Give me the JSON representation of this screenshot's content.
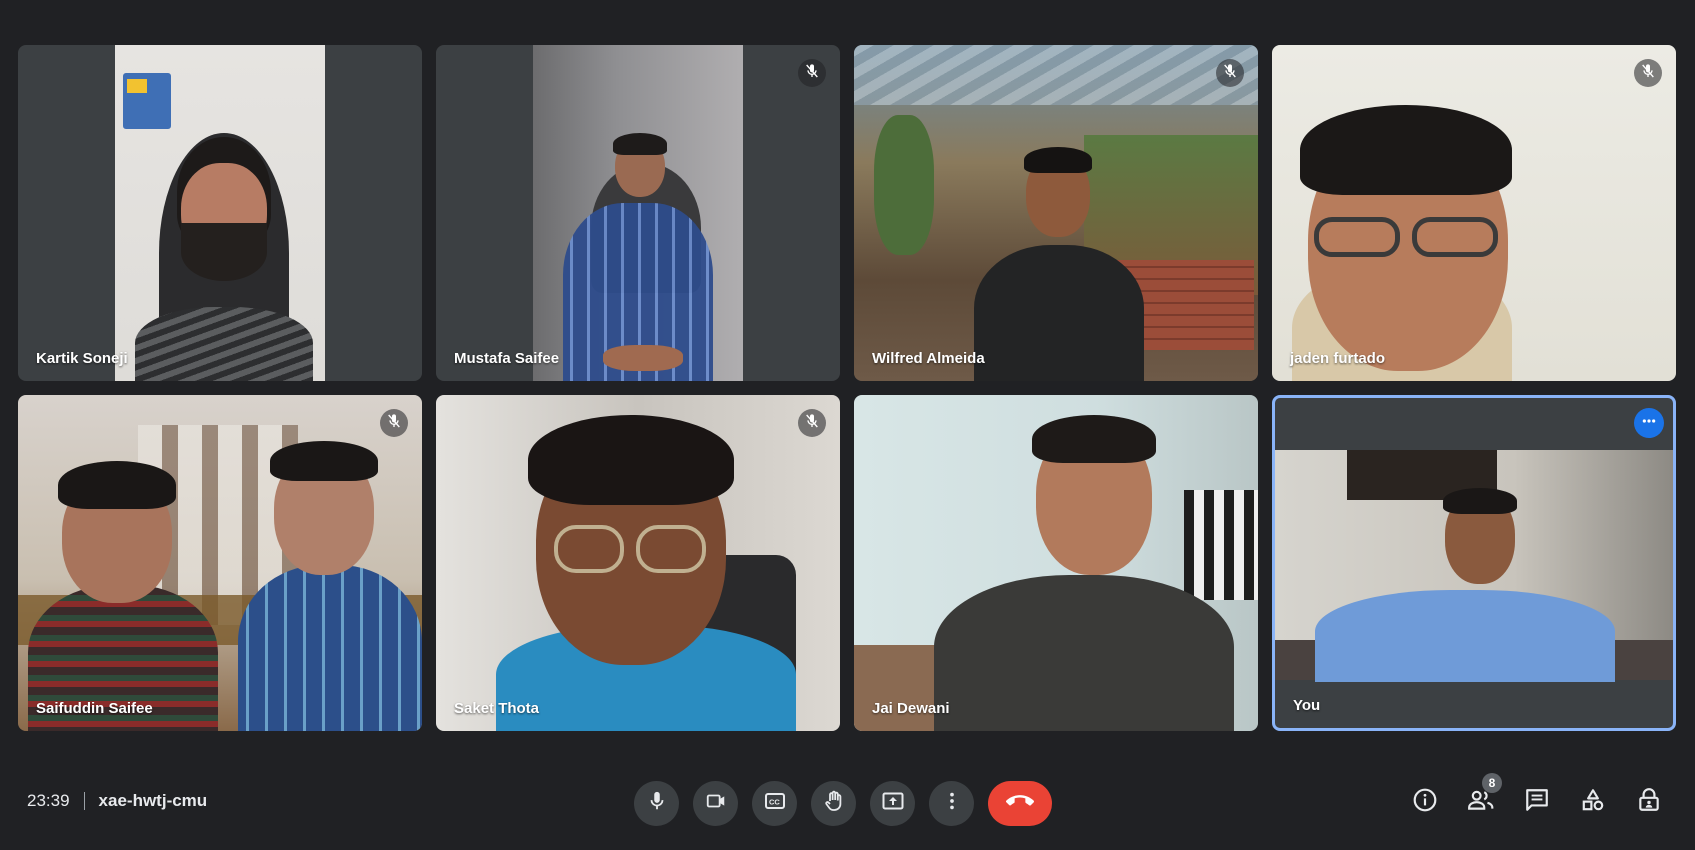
{
  "participants": [
    {
      "name": "Kartik Soneji",
      "muted": false
    },
    {
      "name": "Mustafa Saifee",
      "muted": true
    },
    {
      "name": "Wilfred Almeida",
      "muted": true
    },
    {
      "name": "jaden furtado",
      "muted": true
    },
    {
      "name": "Saifuddin Saifee",
      "muted": true
    },
    {
      "name": "Saket Thota",
      "muted": true
    },
    {
      "name": "Jai Dewani",
      "muted": false
    },
    {
      "name": "You",
      "muted": false,
      "is_self": true
    }
  ],
  "meeting": {
    "time": "23:39",
    "code": "xae-hwtj-cmu"
  },
  "controls": {
    "mic_icon": "mic-icon",
    "camera_icon": "camera-icon",
    "captions_icon": "captions-icon",
    "raise_hand_icon": "hand-icon",
    "present_icon": "present-icon",
    "more_icon": "more-vert-icon",
    "hangup_icon": "phone-hangup-icon"
  },
  "right_panel": {
    "people_count": "8"
  },
  "colors": {
    "background": "#202124",
    "tile": "#3c4043",
    "accent_blue": "#1a73e8",
    "self_border": "#8ab4f8",
    "hangup_red": "#ea4335"
  }
}
